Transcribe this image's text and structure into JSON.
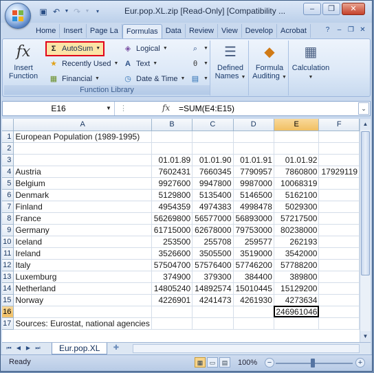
{
  "window": {
    "title": "Eur.pop.XL.zip  [Read-Only]  [Compatibility ...",
    "minimize_label": "–",
    "restore_label": "❐",
    "close_label": "✕"
  },
  "tabs": [
    "Home",
    "Insert",
    "Page La",
    "Formulas",
    "Data",
    "Review",
    "View",
    "Develop",
    "Acrobat"
  ],
  "active_tab": "Formulas",
  "ribbon": {
    "insert_function": {
      "line1": "Insert",
      "line2": "Function"
    },
    "autosum": "AutoSum",
    "recently_used": "Recently Used",
    "financial": "Financial",
    "logical": "Logical",
    "text": "Text",
    "date_time": "Date & Time",
    "group_label": "Function Library",
    "defined_names": {
      "line1": "Defined",
      "line2": "Names"
    },
    "formula_auditing": {
      "line1": "Formula",
      "line2": "Auditing"
    },
    "calculation": "Calculation"
  },
  "formula_bar": {
    "name_box": "E16",
    "fx": "fx",
    "formula": "=SUM(E4:E15)"
  },
  "columns": [
    "A",
    "B",
    "C",
    "D",
    "E",
    "F"
  ],
  "rows": [
    {
      "n": "1",
      "cells": [
        "European Population (1989-1995)",
        "",
        "",
        "",
        "",
        ""
      ]
    },
    {
      "n": "2",
      "cells": [
        "",
        "",
        "",
        "",
        "",
        ""
      ]
    },
    {
      "n": "3",
      "cells": [
        "",
        "01.01.89",
        "01.01.90",
        "01.01.91",
        "01.01.92",
        ""
      ]
    },
    {
      "n": "4",
      "cells": [
        "Austria",
        "7602431",
        "7660345",
        "7790957",
        "7860800",
        "17929119"
      ]
    },
    {
      "n": "5",
      "cells": [
        "Belgium",
        "9927600",
        "9947800",
        "9987000",
        "10068319",
        ""
      ]
    },
    {
      "n": "6",
      "cells": [
        "Denmark",
        "5129800",
        "5135400",
        "5146500",
        "5162100",
        ""
      ]
    },
    {
      "n": "7",
      "cells": [
        "Finland",
        "4954359",
        "4974383",
        "4998478",
        "5029300",
        ""
      ]
    },
    {
      "n": "8",
      "cells": [
        "France",
        "56269800",
        "56577000",
        "56893000",
        "57217500",
        ""
      ]
    },
    {
      "n": "9",
      "cells": [
        "Germany",
        "61715000",
        "62678000",
        "79753000",
        "80238000",
        ""
      ]
    },
    {
      "n": "10",
      "cells": [
        "Iceland",
        "253500",
        "255708",
        "259577",
        "262193",
        ""
      ]
    },
    {
      "n": "11",
      "cells": [
        "Ireland",
        "3526600",
        "3505500",
        "3519000",
        "3542000",
        ""
      ]
    },
    {
      "n": "12",
      "cells": [
        "Italy",
        "57504700",
        "57576400",
        "57746200",
        "57788200",
        ""
      ]
    },
    {
      "n": "13",
      "cells": [
        "Luxemburg",
        "374900",
        "379300",
        "384400",
        "389800",
        ""
      ]
    },
    {
      "n": "14",
      "cells": [
        "Netherland",
        "14805240",
        "14892574",
        "15010445",
        "15129200",
        ""
      ]
    },
    {
      "n": "15",
      "cells": [
        "Norway",
        "4226901",
        "4241473",
        "4261930",
        "4273634",
        ""
      ]
    },
    {
      "n": "16",
      "cells": [
        "",
        "",
        "",
        "",
        "246961046",
        ""
      ]
    },
    {
      "n": "17",
      "cells": [
        "Sources: Eurostat, national agencies",
        "",
        "",
        "",
        "",
        ""
      ]
    }
  ],
  "sheet_tab": "Eur.pop.XL",
  "status": {
    "ready": "Ready",
    "zoom": "100%"
  }
}
